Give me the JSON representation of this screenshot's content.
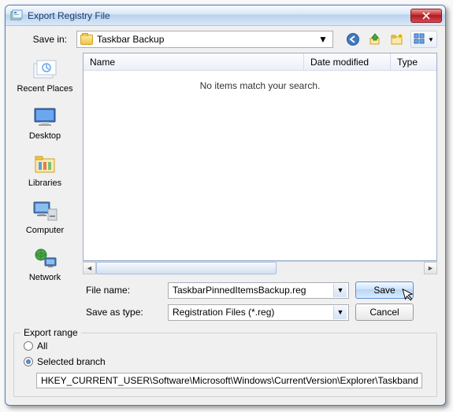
{
  "window": {
    "title": "Export Registry File"
  },
  "savein": {
    "label": "Save in:",
    "folder": "Taskbar Backup"
  },
  "columns": {
    "name": "Name",
    "date": "Date modified",
    "type": "Type"
  },
  "list": {
    "empty_message": "No items match your search."
  },
  "places": [
    {
      "key": "recent",
      "label": "Recent Places"
    },
    {
      "key": "desktop",
      "label": "Desktop"
    },
    {
      "key": "libraries",
      "label": "Libraries"
    },
    {
      "key": "computer",
      "label": "Computer"
    },
    {
      "key": "network",
      "label": "Network"
    }
  ],
  "form": {
    "filename_label": "File name:",
    "filename_value": "TaskbarPinnedItemsBackup.reg",
    "saveastype_label": "Save as type:",
    "saveastype_value": "Registration Files (*.reg)",
    "save_btn": "Save",
    "cancel_btn": "Cancel"
  },
  "export": {
    "legend": "Export range",
    "all_label": "All",
    "selected_label": "Selected branch",
    "selected_checked": true,
    "branch_path": "HKEY_CURRENT_USER\\Software\\Microsoft\\Windows\\CurrentVersion\\Explorer\\Taskband"
  }
}
